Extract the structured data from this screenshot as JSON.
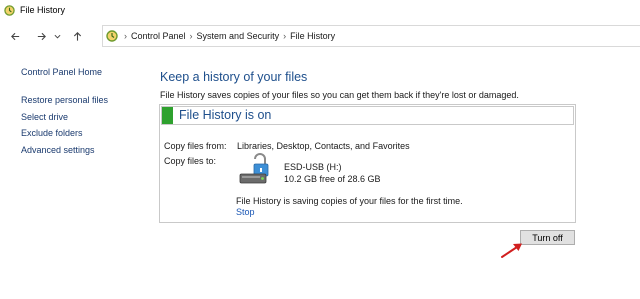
{
  "window": {
    "title": "File History"
  },
  "breadcrumb": [
    "Control Panel",
    "System and Security",
    "File History"
  ],
  "sidebar": {
    "home": "Control Panel Home",
    "links": [
      "Restore personal files",
      "Select drive",
      "Exclude folders",
      "Advanced settings"
    ]
  },
  "main": {
    "heading": "Keep a history of your files",
    "description": "File History saves copies of your files so you can get them back if they're lost or damaged.",
    "status": "File History is on",
    "copy_from_label": "Copy files from:",
    "copy_from_value": "Libraries, Desktop, Contacts, and Favorites",
    "copy_to_label": "Copy files to:",
    "drive_name": "ESD-USB (H:)",
    "drive_free": "10.2 GB free of 28.6 GB",
    "saving_message": "File History is saving copies of your files for the first time.",
    "stop_link": "Stop",
    "turn_off_button": "Turn off"
  },
  "colors": {
    "status_green": "#2ea12e",
    "heading_blue": "#1e4f8c",
    "link_blue": "#1a57b5",
    "annotation_arrow": "#d11f1f"
  },
  "icons": [
    "file-history-icon",
    "back-arrow-icon",
    "forward-arrow-icon",
    "recent-locations-icon",
    "up-arrow-icon",
    "usb-drive-icon",
    "red-annotation-arrow"
  ]
}
